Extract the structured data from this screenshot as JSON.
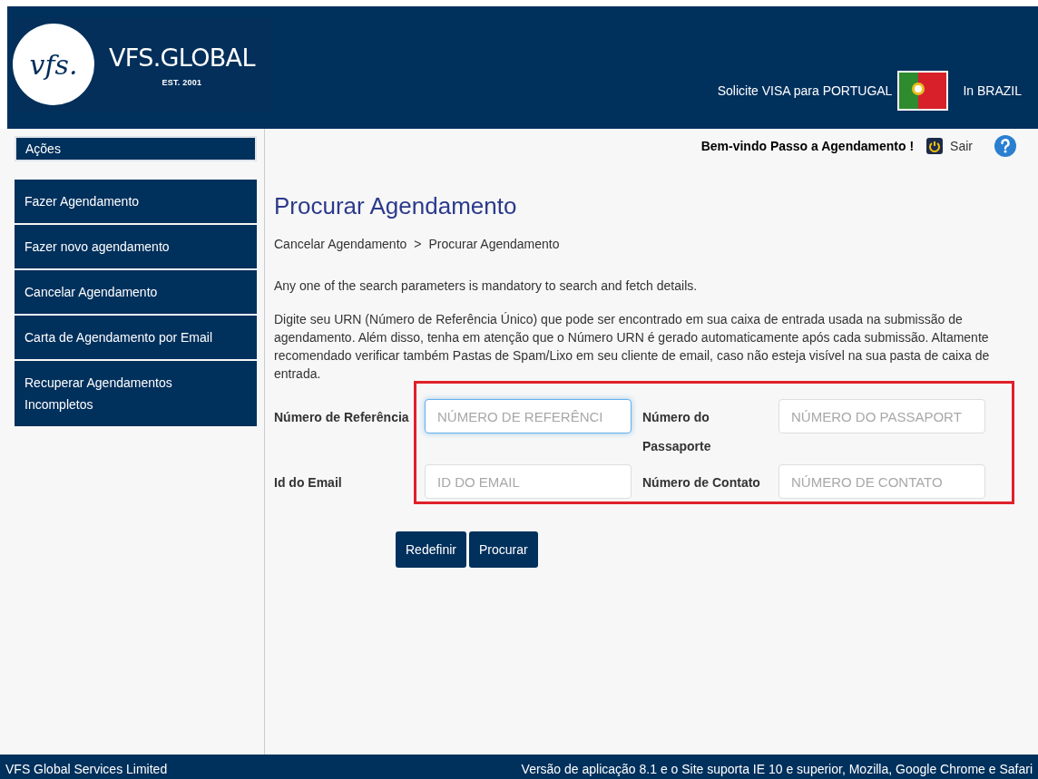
{
  "header": {
    "logo_mark": "vfs.",
    "brand": "VFS.GLOBAL",
    "established": "EST. 2001",
    "apply_text": "Solicite VISA para PORTUGAL",
    "country_text": "In BRAZIL"
  },
  "sidebar": {
    "heading": "Ações",
    "items": [
      {
        "label": "Fazer Agendamento"
      },
      {
        "label": "Fazer novo agendamento"
      },
      {
        "label": "Cancelar Agendamento"
      },
      {
        "label": "Carta de Agendamento por Email"
      },
      {
        "label": "Recuperar Agendamentos Incompletos"
      }
    ]
  },
  "topbar": {
    "welcome": "Bem-vindo Passo a Agendamento !",
    "logout": "Sair"
  },
  "page": {
    "title": "Procurar Agendamento",
    "breadcrumb": [
      "Cancelar Agendamento",
      "Procurar Agendamento"
    ],
    "breadcrumb_separator": ">",
    "notice": "Any one of the search parameters is mandatory to search and fetch details.",
    "instructions": "Digite seu URN (Número de Referência Único) que pode ser encontrado em sua caixa de entrada usada na submissão de agendamento. Além disso, tenha em atenção que o Número URN é gerado automaticamente após cada submissão. Altamente recomendado verificar também Pastas de Spam/Lixo em seu cliente de email, caso não esteja visível na sua pasta de caixa de entrada."
  },
  "form": {
    "highlighted": true,
    "fields": [
      {
        "label": "Número de Referência",
        "placeholder": "NÚMERO DE REFERÊNCI",
        "focused": true
      },
      {
        "label": "Número do Passaporte",
        "placeholder": "NÚMERO DO PASSAPORT",
        "focused": false
      },
      {
        "label": "Id do Email",
        "placeholder": "ID DO EMAIL",
        "focused": false
      },
      {
        "label": "Número de Contato",
        "placeholder": "NÚMERO DE CONTATO",
        "focused": false
      }
    ],
    "buttons": [
      "Redefinir",
      "Procurar"
    ]
  },
  "footer": {
    "left": "VFS Global Services Limited",
    "right": "Versão de aplicação 8.1 e o Site suporta IE 10 e superior, Mozilla, Google Chrome e Safari"
  }
}
